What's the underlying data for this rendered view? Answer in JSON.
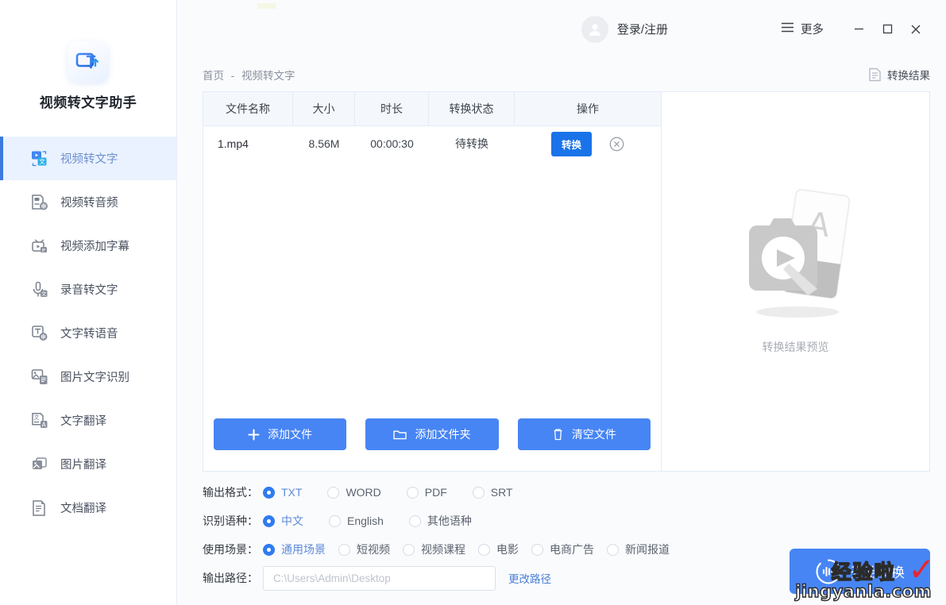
{
  "app": {
    "title": "视频转文字助手",
    "logo_icon": "video-to-text-logo"
  },
  "sidebar": {
    "items": [
      {
        "label": "视频转文字",
        "icon": "video-to-text-icon",
        "active": true
      },
      {
        "label": "视频转音频",
        "icon": "video-to-audio-icon",
        "active": false
      },
      {
        "label": "视频添加字幕",
        "icon": "video-add-subtitle-icon",
        "active": false
      },
      {
        "label": "录音转文字",
        "icon": "audio-to-text-icon",
        "active": false
      },
      {
        "label": "文字转语音",
        "icon": "text-to-speech-icon",
        "active": false
      },
      {
        "label": "图片文字识别",
        "icon": "image-ocr-icon",
        "active": false
      },
      {
        "label": "文字翻译",
        "icon": "text-translate-icon",
        "active": false
      },
      {
        "label": "图片翻译",
        "icon": "image-translate-icon",
        "active": false
      },
      {
        "label": "文档翻译",
        "icon": "document-translate-icon",
        "active": false
      }
    ]
  },
  "titlebar": {
    "account_label": "登录/注册",
    "account_icon": "user-avatar-icon",
    "more_label": "更多",
    "more_icon": "hamburger-icon",
    "minimize_icon": "minimize-icon",
    "maximize_icon": "maximize-icon",
    "close_icon": "close-icon"
  },
  "breadcrumb": {
    "home": "首页",
    "separator": "-",
    "current": "视频转文字"
  },
  "result_button": {
    "label": "转换结果",
    "icon": "document-icon"
  },
  "file_table": {
    "columns": [
      "文件名称",
      "大小",
      "时长",
      "转换状态",
      "操作"
    ],
    "rows": [
      {
        "name": "1.mp4",
        "size": "8.56M",
        "duration": "00:00:30",
        "status": "待转换",
        "action_label": "转换",
        "remove_icon": "remove-circle-icon"
      }
    ]
  },
  "actions": [
    {
      "label": "添加文件",
      "icon": "plus-icon"
    },
    {
      "label": "添加文件夹",
      "icon": "folder-icon"
    },
    {
      "label": "清空文件",
      "icon": "trash-icon"
    }
  ],
  "preview": {
    "label": "转换结果预览",
    "icon": "video-document-placeholder-icon"
  },
  "options": {
    "output_format": {
      "label": "输出格式：",
      "choices": [
        "TXT",
        "WORD",
        "PDF",
        "SRT"
      ],
      "selected": "TXT"
    },
    "language": {
      "label": "识别语种：",
      "choices": [
        "中文",
        "English",
        "其他语种"
      ],
      "selected": "中文"
    },
    "scene": {
      "label": "使用场景：",
      "choices": [
        "通用场景",
        "短视频",
        "视频课程",
        "电影",
        "电商广告",
        "新闻报道"
      ],
      "selected": "通用场景"
    },
    "output_path": {
      "label": "输出路径：",
      "value": "",
      "placeholder": "C:\\Users\\Admin\\Desktop",
      "change_label": "更改路径"
    }
  },
  "start_button": {
    "label": "开始转换",
    "icon": "waveform-circle-icon"
  },
  "watermark": {
    "cn": "经验啦",
    "en": "jingyanla.com",
    "check": "✓"
  },
  "colors": {
    "accent": "#4785f4",
    "accent_strong": "#1a73e8",
    "active_bar": "#3b7ae0",
    "active_bg": "#eaf2ff",
    "page_bg": "#fafbfd",
    "panel_border": "#e3ebf6",
    "table_header_bg": "#f4f8fd",
    "watermark_check": "#e8252b"
  }
}
